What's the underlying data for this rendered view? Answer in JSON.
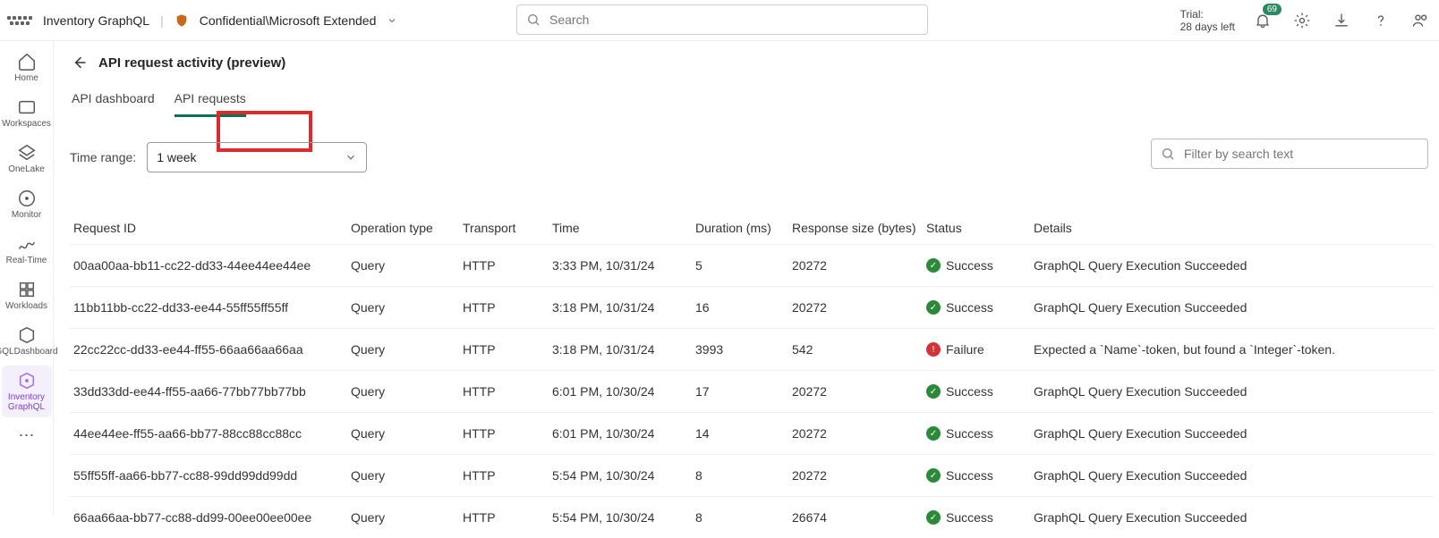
{
  "topbar": {
    "breadcrumb_item": "Inventory GraphQL",
    "breadcrumb_class": "Confidential\\Microsoft Extended",
    "search_placeholder": "Search",
    "trial_label": "Trial:",
    "trial_days": "28 days left",
    "notification_count": "69"
  },
  "leftrail": [
    {
      "key": "home",
      "label": "Home"
    },
    {
      "key": "workspaces",
      "label": "Workspaces"
    },
    {
      "key": "onelake",
      "label": "OneLake"
    },
    {
      "key": "monitor",
      "label": "Monitor"
    },
    {
      "key": "realtime",
      "label": "Real-Time"
    },
    {
      "key": "workloads",
      "label": "Workloads"
    },
    {
      "key": "gqldashboard",
      "label": "GQLDashboard"
    },
    {
      "key": "inventorygraphql",
      "label": "Inventory GraphQL"
    }
  ],
  "page": {
    "title": "API request activity (preview)",
    "tabs": [
      "API dashboard",
      "API requests"
    ],
    "active_tab": 1,
    "time_range_label": "Time range:",
    "time_range_value": "1 week",
    "filter_placeholder": "Filter by search text"
  },
  "columns": [
    "Request ID",
    "Operation type",
    "Transport",
    "Time",
    "Duration (ms)",
    "Response size (bytes)",
    "Status",
    "Details"
  ],
  "rows": [
    {
      "id": "00aa00aa-bb11-cc22-dd33-44ee44ee44ee",
      "op": "Query",
      "transport": "HTTP",
      "time": "3:33 PM, 10/31/24",
      "dur": "5",
      "size": "20272",
      "status": "Success",
      "details": "GraphQL Query Execution Succeeded"
    },
    {
      "id": "11bb11bb-cc22-dd33-ee44-55ff55ff55ff",
      "op": "Query",
      "transport": "HTTP",
      "time": "3:18 PM, 10/31/24",
      "dur": "16",
      "size": "20272",
      "status": "Success",
      "details": "GraphQL Query Execution Succeeded"
    },
    {
      "id": "22cc22cc-dd33-ee44-ff55-66aa66aa66aa",
      "op": "Query",
      "transport": "HTTP",
      "time": "3:18 PM, 10/31/24",
      "dur": "3993",
      "size": "542",
      "status": "Failure",
      "details": "Expected a `Name`-token, but found a `Integer`-token."
    },
    {
      "id": "33dd33dd-ee44-ff55-aa66-77bb77bb77bb",
      "op": "Query",
      "transport": "HTTP",
      "time": "6:01 PM, 10/30/24",
      "dur": "17",
      "size": "20272",
      "status": "Success",
      "details": "GraphQL Query Execution Succeeded"
    },
    {
      "id": "44ee44ee-ff55-aa66-bb77-88cc88cc88cc",
      "op": "Query",
      "transport": "HTTP",
      "time": "6:01 PM, 10/30/24",
      "dur": "14",
      "size": "20272",
      "status": "Success",
      "details": "GraphQL Query Execution Succeeded"
    },
    {
      "id": "55ff55ff-aa66-bb77-cc88-99dd99dd99dd",
      "op": "Query",
      "transport": "HTTP",
      "time": "5:54 PM, 10/30/24",
      "dur": "8",
      "size": "20272",
      "status": "Success",
      "details": "GraphQL Query Execution Succeeded"
    },
    {
      "id": "66aa66aa-bb77-cc88-dd99-00ee00ee00ee",
      "op": "Query",
      "transport": "HTTP",
      "time": "5:54 PM, 10/30/24",
      "dur": "8",
      "size": "26674",
      "status": "Success",
      "details": "GraphQL Query Execution Succeeded"
    }
  ]
}
